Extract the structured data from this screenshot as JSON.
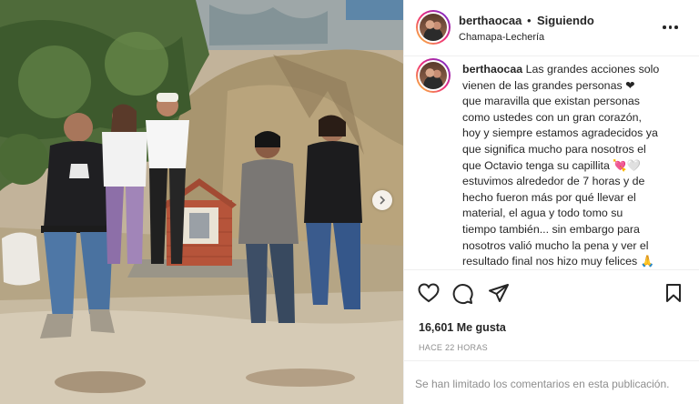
{
  "header": {
    "username": "berthaocaa",
    "separator": "•",
    "follow_status": "Siguiendo",
    "location": "Chamapa-Lechería",
    "more_icon": "more-horizontal-icon"
  },
  "caption": {
    "username": "berthaocaa",
    "lines": [
      "Las grandes acciones solo",
      "vienen de las grandes personas ❤",
      "que maravilla que existan personas",
      "como ustedes con un gran corazón,",
      "hoy y siempre estamos agradecidos ya",
      "que significa mucho para nosotros el",
      "que Octavio tenga su capillita 💘🤍",
      "estuvimos alrededor de 7 horas y de",
      "hecho fueron más por qué llevar el",
      "material, el agua y todo tomo su",
      "tiempo también... sin embargo para",
      "nosotros valió mucho la pena y ver el",
      "resultado final nos hizo muy felices 🙏"
    ]
  },
  "actions": {
    "like_icon": "heart-icon",
    "comment_icon": "comment-icon",
    "share_icon": "share-icon",
    "save_icon": "bookmark-icon"
  },
  "likes": "16,601 Me gusta",
  "timestamp": "HACE 22 HORAS",
  "comments_notice": "Se han limitado los comentarios en esta publicación.",
  "carousel": {
    "next_icon": "chevron-right-icon"
  },
  "colors": {
    "text": "#262626",
    "muted": "#8e8e8e",
    "border": "#efefef",
    "heart": "#e0245e"
  }
}
